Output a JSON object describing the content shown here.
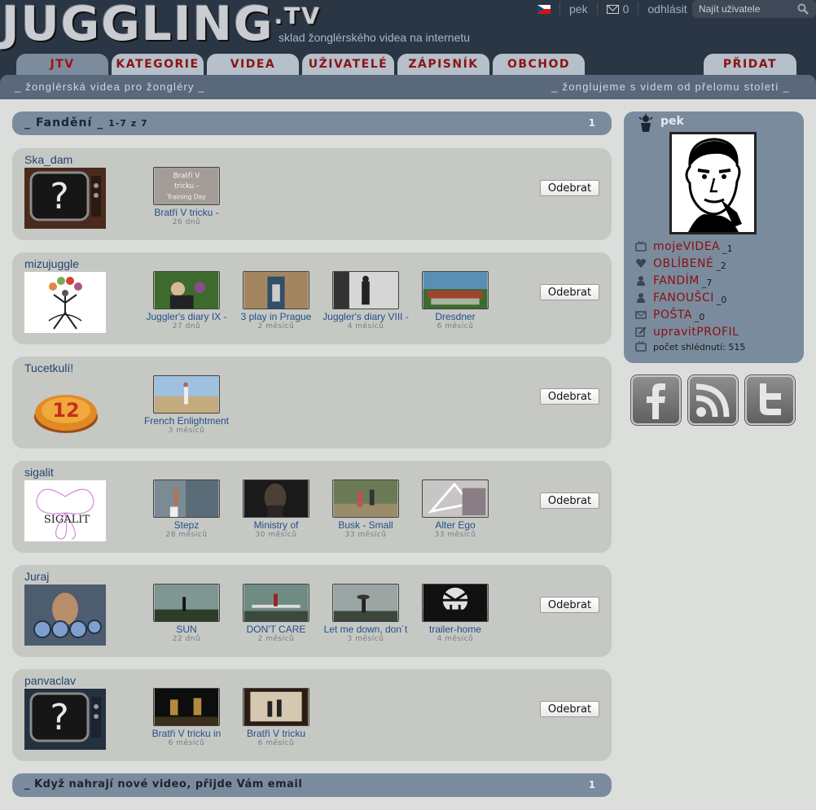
{
  "header": {
    "logo": "JUGGLING",
    "logo_tv": ".TV",
    "tagline": "sklad žonglérského videa na internetu",
    "user": "pek",
    "mail_count": "0",
    "logout": "odhlásit",
    "search_placeholder": "Najít uživatele"
  },
  "tabs": [
    "JTV",
    "KATEGORIE",
    "VIDEA",
    "UŽIVATELÉ",
    "ZÁPISNÍK",
    "OBCHOD"
  ],
  "tab_add": "PŘIDAT",
  "subbar": {
    "left": "_ žonglérská videa pro žongléry _",
    "right": "_ žonglujeme s videm od přelomu století _"
  },
  "section": {
    "title": "_ Fandění _",
    "range": "1-7 z 7",
    "page": "1"
  },
  "remove_label": "Odebrat",
  "fans": [
    {
      "name": "Ska_dam",
      "videos": [
        {
          "title": "Bratři V tricku -",
          "age": "26 dnů"
        }
      ]
    },
    {
      "name": "mizujuggle",
      "videos": [
        {
          "title": "Juggler's diary IX -",
          "age": "27 dnů"
        },
        {
          "title": "3 play in Prague",
          "age": "2 měsíců"
        },
        {
          "title": "Juggler's diary VIII -",
          "age": "4 měsíců"
        },
        {
          "title": "Dresdner",
          "age": "6 měsíců"
        }
      ]
    },
    {
      "name": "Tucetkulí!",
      "videos": [
        {
          "title": "French Enlightment",
          "age": "3 měsíců"
        }
      ]
    },
    {
      "name": "sigalit",
      "videos": [
        {
          "title": "Stepz",
          "age": "28 měsíců"
        },
        {
          "title": "Ministry of",
          "age": "30 měsíců"
        },
        {
          "title": "Busk - Small",
          "age": "33 měsíců"
        },
        {
          "title": "Alter Ego",
          "age": "33 měsíců"
        }
      ]
    },
    {
      "name": "Juraj",
      "videos": [
        {
          "title": "SUN",
          "age": "22 dnů"
        },
        {
          "title": "DON'T CARE",
          "age": "2 měsíců"
        },
        {
          "title": "Let me down, don´t",
          "age": "3 měsíců"
        },
        {
          "title": "trailer-home",
          "age": "4 měsíců"
        }
      ]
    },
    {
      "name": "panvaclav",
      "videos": [
        {
          "title": "Bratři V tricku in",
          "age": "6 měsíců"
        },
        {
          "title": "Bratři V tricku",
          "age": "6 měsíců"
        }
      ]
    }
  ],
  "avatar_text": {
    "ska_dam": "?",
    "panvaclav": "?",
    "sigalit": "SIGALIT",
    "tucetkuli": "12"
  },
  "thumb_caption_ska": "Bratři V tricku - Training Day",
  "footer_bar": {
    "title": "_ Když nahrají nové video, přijde Vám email",
    "page": "1"
  },
  "profile": {
    "name": "pek",
    "links": [
      {
        "label": "mojeVIDEA",
        "count": "_1",
        "icon": "tv-icon"
      },
      {
        "label": "OBLÍBENÉ",
        "count": "_2",
        "icon": "heart-icon"
      },
      {
        "label": "FANDÍM",
        "count": "_7",
        "icon": "person-icon"
      },
      {
        "label": "FANOUŠCI",
        "count": "_0",
        "icon": "person-icon"
      },
      {
        "label": "POŠTA",
        "count": "_0",
        "icon": "mail-icon"
      },
      {
        "label": "upravitPROFIL",
        "count": "",
        "icon": "edit-icon"
      }
    ],
    "views": "počet shlédnutí: 515"
  },
  "colors": {
    "accent": "#8b1414",
    "header_bg": "#2b3645",
    "panel": "#7a8b9d",
    "card": "#c6c8c4"
  }
}
